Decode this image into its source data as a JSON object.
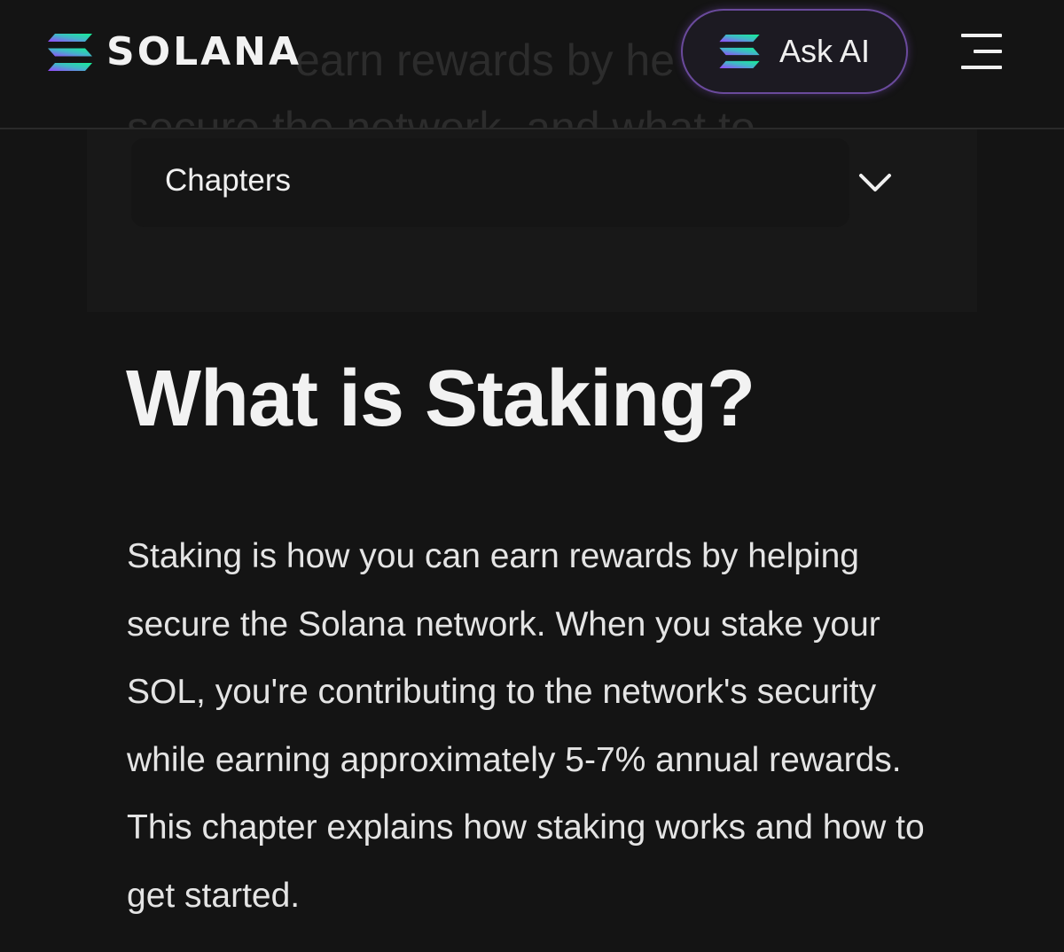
{
  "header": {
    "logo_text": "SOLANA",
    "ask_ai_label": "Ask AI"
  },
  "ghost": {
    "line1": "earn rewards by he",
    "line2": "secure the network, and what to"
  },
  "chapters": {
    "label": "Chapters"
  },
  "article": {
    "title": "What is Staking?",
    "body": "Staking is how you can earn rewards by helping secure the Solana network. When you stake your SOL, you're contributing to the network's security while earning approximately 5-7% annual rewards. This chapter explains how staking works and how to get started."
  },
  "colors": {
    "background": "#141414",
    "ask_ai_border": "#6a4a9c",
    "logo_gradient_start": "#9945ff",
    "logo_gradient_end": "#14f195"
  },
  "icons": {
    "logo": "solana-logo-icon",
    "ask_ai": "solana-logo-icon",
    "menu": "hamburger-menu-icon",
    "chevron": "chevron-down-icon"
  }
}
